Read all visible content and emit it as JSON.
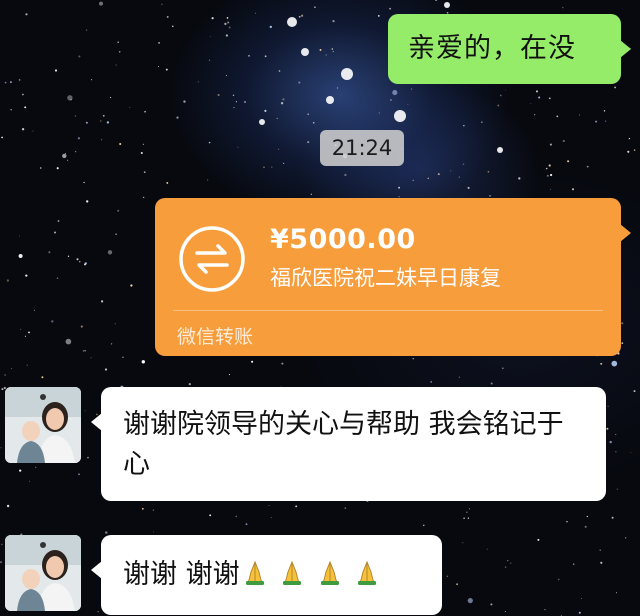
{
  "messages": {
    "outgoing_text": "亲爱的，在没",
    "timestamp": "21:24",
    "transfer": {
      "amount": "¥5000.00",
      "note": "福欣医院祝二妹早日康复",
      "footer": "微信转账",
      "icon": "transfer-arrows-icon",
      "color": "#f79d3c"
    },
    "reply_1": "谢谢院领导的关心与帮助  我会铭记于心",
    "reply_2": "谢谢  谢谢",
    "reply_2_emoji": "folded-hands-icon x4"
  },
  "colors": {
    "outgoing_bubble": "#95ec69",
    "incoming_bubble": "#ffffff",
    "background": "#07090f"
  }
}
